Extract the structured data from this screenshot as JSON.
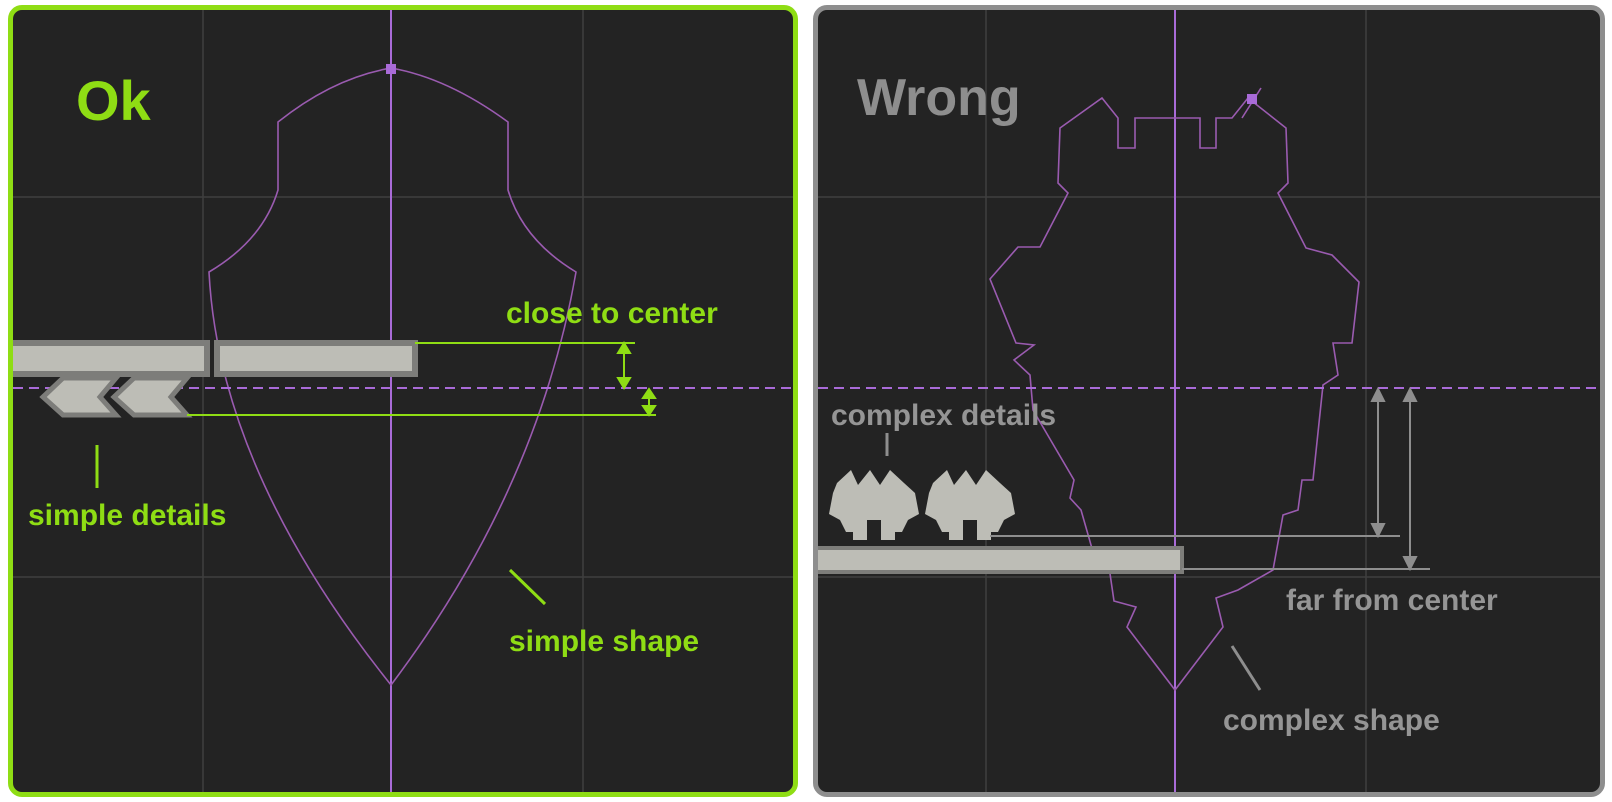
{
  "colors": {
    "good": "#8fdd14",
    "bad": "#8e8e8e",
    "panel_bg": "#232323",
    "grid": "#3f3f3f",
    "guide": "#a96bd8",
    "shape_outline": "#9a5bb0",
    "ship_part": "#bdbdb6"
  },
  "ok_panel": {
    "title": "Ok",
    "annotations": {
      "close_to_center": "close to center",
      "simple_details": "simple details",
      "simple_shape": "simple shape"
    }
  },
  "wrong_panel": {
    "title": "Wrong",
    "annotations": {
      "complex_details": "complex details",
      "far_from_center": "far from center",
      "complex_shape": "complex shape"
    }
  }
}
